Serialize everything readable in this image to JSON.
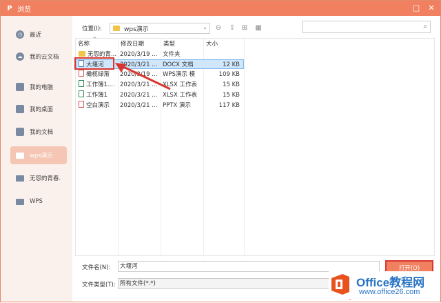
{
  "window": {
    "title": "浏览",
    "title_icon": "P"
  },
  "sidebar": {
    "items": [
      {
        "label": "最近",
        "icon": "clock-icon"
      },
      {
        "label": "我的云文档",
        "icon": "cloud-icon"
      },
      {
        "label": "我的电脑",
        "icon": "computer-icon"
      },
      {
        "label": "我的桌面",
        "icon": "desktop-icon"
      },
      {
        "label": "我的文档",
        "icon": "documents-icon"
      },
      {
        "label": "wps演示",
        "icon": "folder-icon",
        "active": true
      },
      {
        "label": "无怨的青春.",
        "icon": "folder-icon"
      },
      {
        "label": "WPS",
        "icon": "folder-icon"
      }
    ]
  },
  "toolbar": {
    "location_label": "位置(I):",
    "location_value": "wps演示"
  },
  "columns": {
    "name": "名称",
    "modified": "修改日期",
    "type": "类型",
    "size": "大小"
  },
  "files": [
    {
      "name": "无怨的青...",
      "modified": "2020/3/19 ...",
      "type": "文件夹",
      "size": "",
      "kind": "folder"
    },
    {
      "name": "大堰河",
      "modified": "2020/3/21 ...",
      "type": "DOCX 文档",
      "size": "12 KB",
      "kind": "docx",
      "selected": true
    },
    {
      "name": "橄榄绿渐",
      "modified": "2020/3/19 ...",
      "type": "WPS演示 模",
      "size": "109 KB",
      "kind": "wps"
    },
    {
      "name": "工作簿1....",
      "modified": "2020/3/21 ...",
      "type": "XLSX 工作表",
      "size": "15 KB",
      "kind": "xlsx"
    },
    {
      "name": "工作簿1",
      "modified": "2020/3/21 ...",
      "type": "XLSX 工作表",
      "size": "15 KB",
      "kind": "xlsx"
    },
    {
      "name": "空白演示",
      "modified": "2020/3/21 ...",
      "type": "PPTX 演示",
      "size": "117 KB",
      "kind": "pptx"
    }
  ],
  "bottom": {
    "filename_label": "文件名(N):",
    "filename_value": "大堰河",
    "filetype_label": "文件类型(T):",
    "filetype_value": "所有文件(*.*)",
    "open_button": "打开(O)"
  },
  "watermark": {
    "title": "Office教程网",
    "url": "www.office26.com"
  },
  "colors": {
    "accent": "#f0805f",
    "highlight": "#d9362f",
    "selected_row": "#cfe6fb"
  }
}
